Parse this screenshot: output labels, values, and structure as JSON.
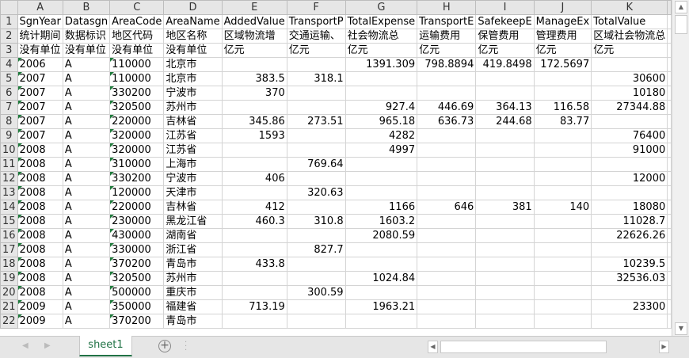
{
  "columns": [
    "A",
    "B",
    "C",
    "D",
    "E",
    "F",
    "G",
    "H",
    "I",
    "J",
    "K",
    ""
  ],
  "rows": [
    {
      "n": "1",
      "c": [
        "SgnYear",
        "Datasgn",
        "AreaCode",
        "AreaName",
        "AddedValue",
        "TransportP",
        "TotalExpense",
        "TransportE",
        "SafekeepE",
        "ManageEx",
        "TotalValue",
        ""
      ]
    },
    {
      "n": "2",
      "c": [
        "统计期间",
        "数据标识",
        "地区代码",
        "地区名称",
        "区域物流增",
        "交通运输、",
        "社会物流总",
        "运输费用",
        "保管费用",
        "管理费用",
        "区域社会物流总",
        ""
      ]
    },
    {
      "n": "3",
      "c": [
        "没有单位",
        "没有单位",
        "没有单位",
        "没有单位",
        "亿元",
        "亿元",
        "亿元",
        "亿元",
        "亿元",
        "亿元",
        "亿元",
        ""
      ]
    },
    {
      "n": "4",
      "c": [
        "2006",
        "A",
        "110000",
        "北京市",
        "",
        "",
        "1391.309",
        "798.8894",
        "419.8498",
        "172.5697",
        "",
        ""
      ]
    },
    {
      "n": "5",
      "c": [
        "2007",
        "A",
        "110000",
        "北京市",
        "383.5",
        "318.1",
        "",
        "",
        "",
        "",
        "30600",
        ""
      ]
    },
    {
      "n": "6",
      "c": [
        "2007",
        "A",
        "330200",
        "宁波市",
        "370",
        "",
        "",
        "",
        "",
        "",
        "10180",
        ""
      ]
    },
    {
      "n": "7",
      "c": [
        "2007",
        "A",
        "320500",
        "苏州市",
        "",
        "",
        "927.4",
        "446.69",
        "364.13",
        "116.58",
        "27344.88",
        ""
      ]
    },
    {
      "n": "8",
      "c": [
        "2007",
        "A",
        "220000",
        "吉林省",
        "345.86",
        "273.51",
        "965.18",
        "636.73",
        "244.68",
        "83.77",
        "",
        ""
      ]
    },
    {
      "n": "9",
      "c": [
        "2007",
        "A",
        "320000",
        "江苏省",
        "1593",
        "",
        "4282",
        "",
        "",
        "",
        "76400",
        ""
      ]
    },
    {
      "n": "10",
      "c": [
        "2008",
        "A",
        "320000",
        "江苏省",
        "",
        "",
        "4997",
        "",
        "",
        "",
        "91000",
        ""
      ]
    },
    {
      "n": "11",
      "c": [
        "2008",
        "A",
        "310000",
        "上海市",
        "",
        "769.64",
        "",
        "",
        "",
        "",
        "",
        ""
      ]
    },
    {
      "n": "12",
      "c": [
        "2008",
        "A",
        "330200",
        "宁波市",
        "406",
        "",
        "",
        "",
        "",
        "",
        "12000",
        ""
      ]
    },
    {
      "n": "13",
      "c": [
        "2008",
        "A",
        "120000",
        "天津市",
        "",
        "320.63",
        "",
        "",
        "",
        "",
        "",
        ""
      ]
    },
    {
      "n": "14",
      "c": [
        "2008",
        "A",
        "220000",
        "吉林省",
        "412",
        "",
        "1166",
        "646",
        "381",
        "140",
        "18080",
        ""
      ]
    },
    {
      "n": "15",
      "c": [
        "2008",
        "A",
        "230000",
        "黑龙江省",
        "460.3",
        "310.8",
        "1603.2",
        "",
        "",
        "",
        "11028.7",
        ""
      ]
    },
    {
      "n": "16",
      "c": [
        "2008",
        "A",
        "430000",
        "湖南省",
        "",
        "",
        "2080.59",
        "",
        "",
        "",
        "22626.26",
        ""
      ]
    },
    {
      "n": "17",
      "c": [
        "2008",
        "A",
        "330000",
        "浙江省",
        "",
        "827.7",
        "",
        "",
        "",
        "",
        "",
        ""
      ]
    },
    {
      "n": "18",
      "c": [
        "2008",
        "A",
        "370200",
        "青岛市",
        "433.8",
        "",
        "",
        "",
        "",
        "",
        "10239.5",
        ""
      ]
    },
    {
      "n": "19",
      "c": [
        "2008",
        "A",
        "320500",
        "苏州市",
        "",
        "",
        "1024.84",
        "",
        "",
        "",
        "32536.03",
        ""
      ]
    },
    {
      "n": "20",
      "c": [
        "2008",
        "A",
        "500000",
        "重庆市",
        "",
        "300.59",
        "",
        "",
        "",
        "",
        "",
        ""
      ]
    },
    {
      "n": "21",
      "c": [
        "2009",
        "A",
        "350000",
        "福建省",
        "713.19",
        "",
        "1963.21",
        "",
        "",
        "",
        "23300",
        ""
      ]
    },
    {
      "n": "22",
      "c": [
        "2009",
        "A",
        "370200",
        "青岛市",
        "",
        "",
        "",
        "",
        "",
        "",
        "",
        ""
      ]
    }
  ],
  "sheet_tab": "sheet1",
  "add_sheet": "+",
  "colors": {
    "accent": "#217346",
    "triangle": "#1e7a3b"
  }
}
